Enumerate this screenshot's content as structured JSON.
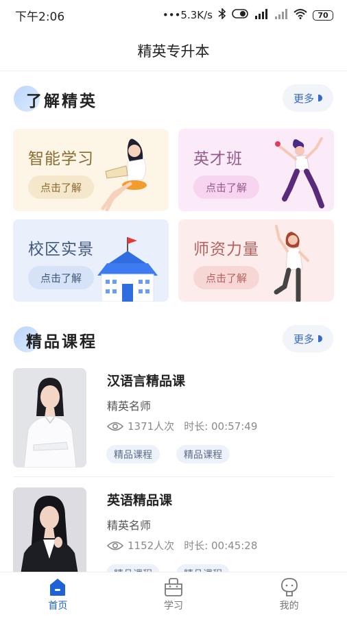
{
  "status_bar": {
    "time": "下午2:06",
    "network_speed": "•••5.3K/s",
    "battery": "70"
  },
  "header": {
    "title": "精英专升本"
  },
  "about_section": {
    "title": "了解精英",
    "more_label": "更多",
    "cards": [
      {
        "title": "智能学习",
        "button": "点击了解"
      },
      {
        "title": "英才班",
        "button": "点击了解"
      },
      {
        "title": "校区实景",
        "button": "点击了解"
      },
      {
        "title": "师资力量",
        "button": "点击了解"
      }
    ]
  },
  "courses_section": {
    "title": "精品课程",
    "more_label": "更多",
    "courses": [
      {
        "name": "汉语言精品课",
        "teacher": "精英名师",
        "views": "1371人次",
        "duration": "时长: 00:57:49",
        "tags": [
          "精品课程",
          "精品课程"
        ]
      },
      {
        "name": "英语精品课",
        "teacher": "精英名师",
        "views": "1152人次",
        "duration": "时长: 00:45:28",
        "tags": [
          "精品课程",
          "精品课程"
        ]
      }
    ]
  },
  "tab_bar": {
    "tabs": [
      {
        "label": "首页",
        "icon": "home-icon",
        "active": true
      },
      {
        "label": "学习",
        "icon": "study-icon",
        "active": false
      },
      {
        "label": "我的",
        "icon": "profile-icon",
        "active": false
      }
    ]
  },
  "colors": {
    "accent": "#1e63d6",
    "more_text": "#3468c9"
  }
}
